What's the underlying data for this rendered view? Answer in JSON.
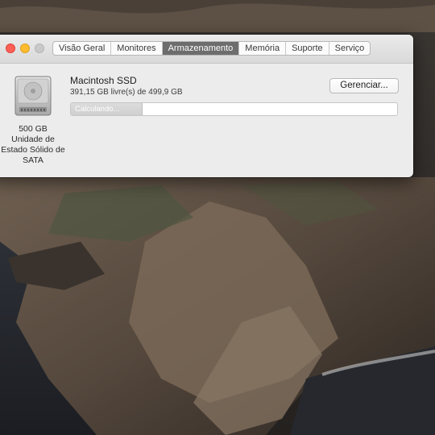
{
  "window": {
    "tabs": [
      {
        "label": "Visão Geral",
        "active": false
      },
      {
        "label": "Monitores",
        "active": false
      },
      {
        "label": "Armazenamento",
        "active": true
      },
      {
        "label": "Memória",
        "active": false
      },
      {
        "label": "Suporte",
        "active": false
      },
      {
        "label": "Serviço",
        "active": false
      }
    ]
  },
  "disk": {
    "icon": "internal-drive-icon",
    "capacity": "500 GB",
    "type_line1": "Unidade de",
    "type_line2": "Estado Sólido de",
    "type_line3": "SATA",
    "name": "Macintosh SSD",
    "free_text": "391,15 GB livre(s) de 499,9 GB",
    "manage_label": "Gerenciar...",
    "usage_status": "Calculando...",
    "usage_progress": 0.22
  },
  "colors": {
    "close": "#fe5f57",
    "minimize": "#febc2e",
    "zoom_disabled": "#c9c9c9",
    "active_tab": "#6d6d6d"
  }
}
